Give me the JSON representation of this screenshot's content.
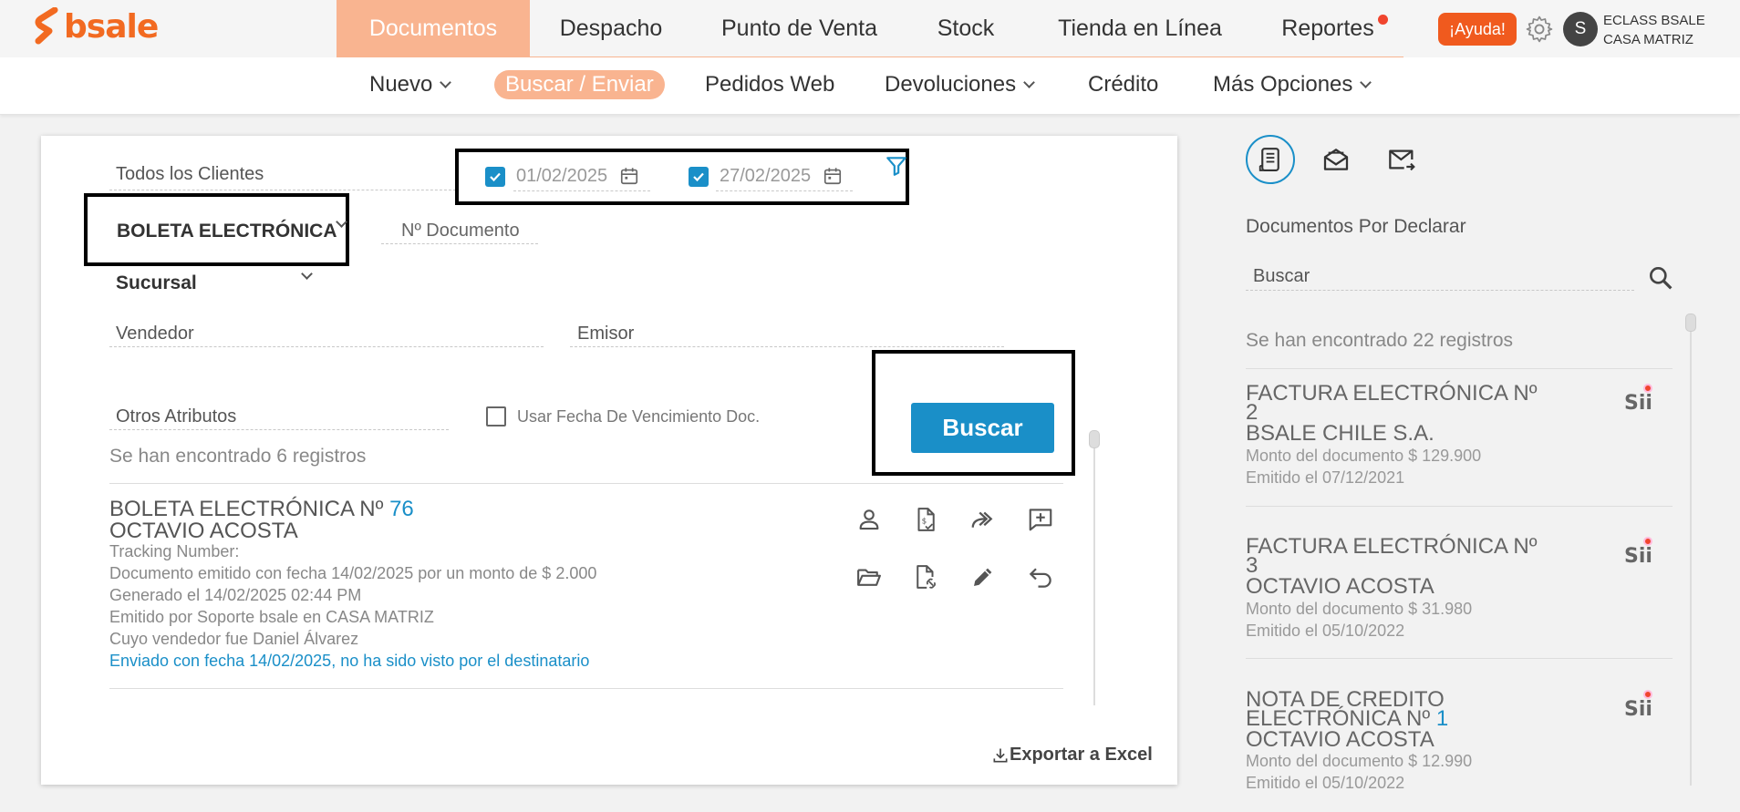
{
  "brand": {
    "name": "bsale"
  },
  "nav": {
    "items": [
      {
        "label": "Documentos"
      },
      {
        "label": "Despacho"
      },
      {
        "label": "Punto de Venta"
      },
      {
        "label": "Stock"
      },
      {
        "label": "Tienda en Línea"
      },
      {
        "label": "Reportes"
      }
    ],
    "help_label": "¡Ayuda!",
    "avatar_initial": "S",
    "company_line1": "ECLASS BSALE",
    "company_line2": "CASA MATRIZ"
  },
  "subnav": {
    "items": [
      {
        "label": "Nuevo"
      },
      {
        "label": "Buscar / Enviar"
      },
      {
        "label": "Pedidos Web"
      },
      {
        "label": "Devoluciones"
      },
      {
        "label": "Crédito"
      },
      {
        "label": "Más Opciones"
      }
    ]
  },
  "filters": {
    "clientes": "Todos los Clientes",
    "date_from": "01/02/2025",
    "date_to": "27/02/2025",
    "doc_type": "BOLETA ELECTRÓNICA",
    "doc_number_placeholder": "Nº Documento",
    "sucursal": "Sucursal",
    "vendedor": "Vendedor",
    "emisor": "Emisor",
    "otros": "Otros Atributos",
    "usar_fecha_label": "Usar Fecha De Vencimiento Doc.",
    "search_button": "Buscar"
  },
  "results": {
    "count_text": "Se han encontrado 6 registros",
    "doc": {
      "title": "BOLETA ELECTRÓNICA Nº",
      "number": "76",
      "client": "OCTAVIO ACOSTA",
      "tracking": "Tracking Number:",
      "line1": "Documento emitido con fecha 14/02/2025 por un monto de $ 2.000",
      "line2": "Generado el 14/02/2025 02:44 PM",
      "line3": "Emitido por Soporte bsale en CASA MATRIZ",
      "line4": "Cuyo vendedor fue Daniel Álvarez",
      "sent": "Enviado con fecha 14/02/2025, no ha sido visto por el destinatario"
    },
    "export_label": "Exportar a Excel"
  },
  "side_panel": {
    "title": "Documentos Por Declarar",
    "search_placeholder": "Buscar",
    "count_text": "Se han encontrado 22 registros",
    "badge": "Sii",
    "items": [
      {
        "title": "FACTURA ELECTRÓNICA Nº",
        "number": "2",
        "client": "BSALE CHILE S.A.",
        "amount": "Monto del documento $ 129.900",
        "issued": "Emitido el 07/12/2021"
      },
      {
        "title": "FACTURA ELECTRÓNICA Nº",
        "number": "3",
        "client": "OCTAVIO ACOSTA",
        "amount": "Monto del documento $ 31.980",
        "issued": "Emitido el 05/10/2022"
      },
      {
        "title": "NOTA DE CRÉDITO",
        "title2": "ELECTRÓNICA Nº",
        "number": "1",
        "client": "OCTAVIO ACOSTA",
        "amount": "Monto del documento $ 12.990",
        "issued": "Emitido el 05/10/2022"
      }
    ]
  },
  "colors": {
    "brand": "#f26a21",
    "accent": "#1a8fc8",
    "nav_active": "#f9b490",
    "help": "#f05a1e"
  },
  "icons": [
    "bsale-logo-icon",
    "gear-icon",
    "calendar-icon",
    "filter-icon",
    "chevron-down-icon",
    "user-icon",
    "invoice-icon",
    "forward-icon",
    "add-comment-icon",
    "folder-open-icon",
    "file-link-icon",
    "pencil-icon",
    "undo-icon",
    "download-icon",
    "receipt-icon",
    "mail-open-icon",
    "mail-send-icon",
    "search-icon"
  ]
}
